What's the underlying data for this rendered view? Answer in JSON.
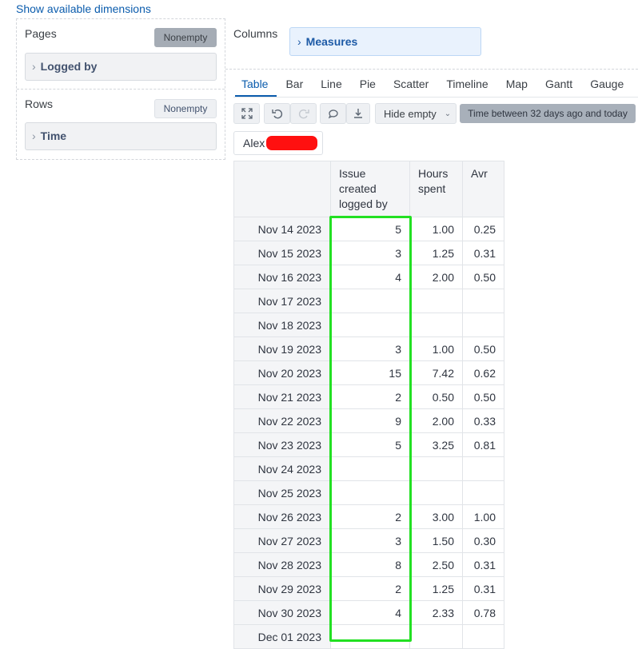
{
  "top_link": "Show available dimensions",
  "pages": {
    "title": "Pages",
    "nonempty": "Nonempty",
    "dimension": "Logged by"
  },
  "rows": {
    "title": "Rows",
    "nonempty": "Nonempty",
    "dimension": "Time"
  },
  "columns": {
    "title": "Columns",
    "dimension": "Measures"
  },
  "tabs": [
    "Table",
    "Bar",
    "Line",
    "Pie",
    "Scatter",
    "Timeline",
    "Map",
    "Gantt",
    "Gauge"
  ],
  "active_tab": "Table",
  "toolbar": {
    "hide_empty": "Hide empty",
    "filter": "Time between 32 days ago and today",
    "icons": [
      "expand-icon",
      "undo-icon",
      "redo-icon",
      "comment-icon",
      "download-icon"
    ]
  },
  "page_selector": {
    "value": "Alex"
  },
  "table": {
    "headers": [
      "Issue created logged by",
      "Hours spent",
      "Avr"
    ],
    "rows": [
      [
        "Nov 14 2023",
        "5",
        "1.00",
        "0.25"
      ],
      [
        "Nov 15 2023",
        "3",
        "1.25",
        "0.31"
      ],
      [
        "Nov 16 2023",
        "4",
        "2.00",
        "0.50"
      ],
      [
        "Nov 17 2023",
        "",
        "",
        ""
      ],
      [
        "Nov 18 2023",
        "",
        "",
        ""
      ],
      [
        "Nov 19 2023",
        "3",
        "1.00",
        "0.50"
      ],
      [
        "Nov 20 2023",
        "15",
        "7.42",
        "0.62"
      ],
      [
        "Nov 21 2023",
        "2",
        "0.50",
        "0.50"
      ],
      [
        "Nov 22 2023",
        "9",
        "2.00",
        "0.33"
      ],
      [
        "Nov 23 2023",
        "5",
        "3.25",
        "0.81"
      ],
      [
        "Nov 24 2023",
        "",
        "",
        ""
      ],
      [
        "Nov 25 2023",
        "",
        "",
        ""
      ],
      [
        "Nov 26 2023",
        "2",
        "3.00",
        "1.00"
      ],
      [
        "Nov 27 2023",
        "3",
        "1.50",
        "0.30"
      ],
      [
        "Nov 28 2023",
        "8",
        "2.50",
        "0.31"
      ],
      [
        "Nov 29 2023",
        "2",
        "1.25",
        "0.31"
      ],
      [
        "Nov 30 2023",
        "4",
        "2.33",
        "0.78"
      ],
      [
        "Dec 01 2023",
        "",
        "",
        ""
      ]
    ]
  },
  "colors": {
    "highlight": "#22e022",
    "redaction": "#ff1010",
    "accent": "#0b5cad"
  }
}
